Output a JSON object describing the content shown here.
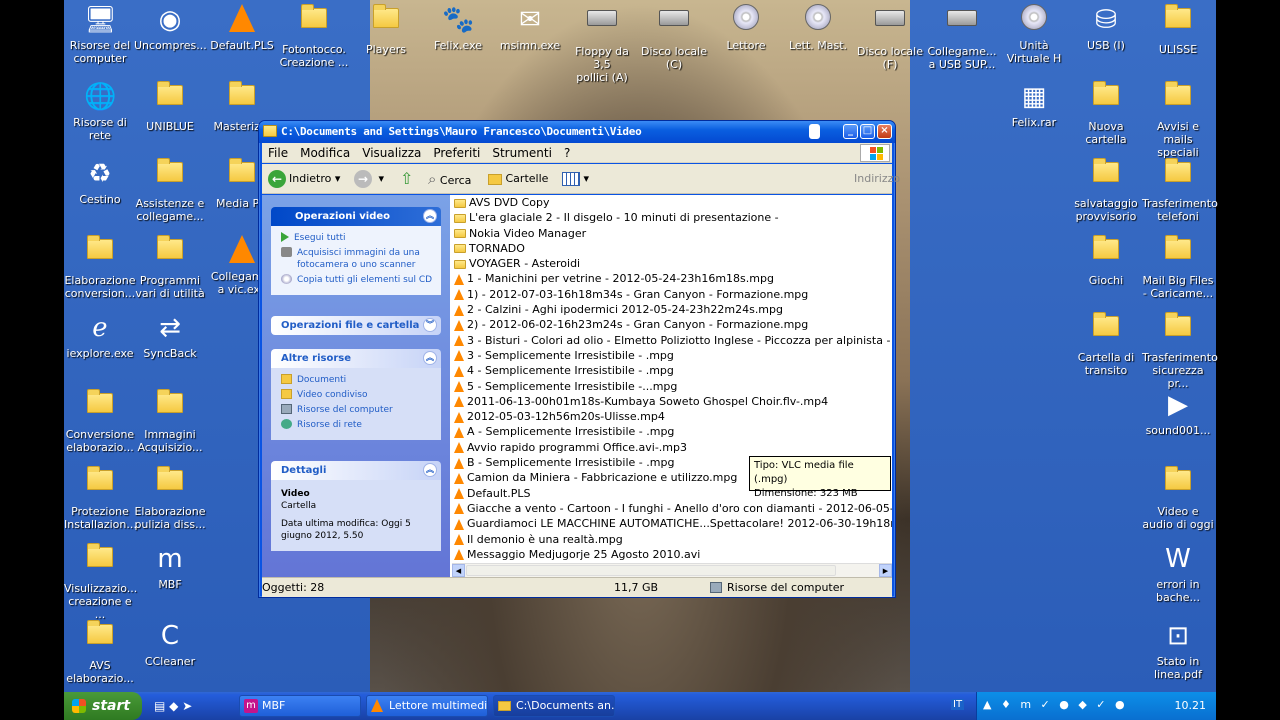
{
  "desktop": {
    "icons_top": [
      {
        "label": "Risorse del\ncomputer",
        "icon": "computer-icon"
      },
      {
        "label": "Uncompres...",
        "icon": "compressed-icon"
      },
      {
        "label": "Default.PLS",
        "icon": "vlc-icon"
      },
      {
        "label": "Fotontocco.\nCreazione ...",
        "icon": "folder-icon"
      },
      {
        "label": "Players",
        "icon": "folder-icon"
      },
      {
        "label": "Felix.exe",
        "icon": "paw-icon"
      },
      {
        "label": "msimn.exe",
        "icon": "mail-icon"
      },
      {
        "label": "Floppy da 3,5\npollici (A)",
        "icon": "floppy-icon"
      },
      {
        "label": "Disco locale\n(C)",
        "icon": "drive-icon"
      },
      {
        "label": "Lettore",
        "icon": "cd-icon"
      },
      {
        "label": "Lett. Mast.",
        "icon": "cd-icon"
      },
      {
        "label": "Disco locale\n(F)",
        "icon": "drive-icon"
      },
      {
        "label": "Collegame...\na USB SUP...",
        "icon": "drive-icon"
      },
      {
        "label": "Unità\nVirtuale H",
        "icon": "dvd-icon"
      },
      {
        "label": "USB (I)",
        "icon": "usb-icon"
      },
      {
        "label": "ULISSE",
        "icon": "folder-icon"
      }
    ],
    "icons_left": [
      {
        "label": "Risorse di rete",
        "icon": "network-icon"
      },
      {
        "label": "UNIBLUE",
        "icon": "folder-icon"
      },
      {
        "label": "Masteriz...",
        "icon": "folder-icon"
      },
      {
        "label": "Cestino",
        "icon": "recycle-bin-icon"
      },
      {
        "label": "Assistenze e\ncollegame...",
        "icon": "folder-icon"
      },
      {
        "label": "Media P...",
        "icon": "folder-icon"
      },
      {
        "label": "Elaborazione\nconversion...",
        "icon": "folder-icon"
      },
      {
        "label": "Programmi\nvari di utilità",
        "icon": "folder-icon"
      },
      {
        "label": "Collegam...\na vic.exe",
        "icon": "vlc-icon"
      },
      {
        "label": "iexplore.exe",
        "icon": "ie-icon"
      },
      {
        "label": "SyncBack",
        "icon": "syncback-icon"
      },
      {
        "label": "Conversione\nelaborazio...",
        "icon": "folder-icon"
      },
      {
        "label": "Immagini\nAcquisizio...",
        "icon": "folder-icon"
      },
      {
        "label": "Protezione\nInstallazion...",
        "icon": "folder-icon"
      },
      {
        "label": "Elaborazione\npulizia diss...",
        "icon": "folder-icon"
      },
      {
        "label": "Visulizzazio...\ncreazione e ...",
        "icon": "folder-icon"
      },
      {
        "label": "MBF",
        "icon": "mbf-icon"
      },
      {
        "label": "AVS\nelaborazio...",
        "icon": "folder-icon"
      },
      {
        "label": "CCleaner",
        "icon": "ccleaner-icon"
      }
    ],
    "icons_right": [
      {
        "label": "Felix.rar",
        "icon": "rar-icon"
      },
      {
        "label": "Nuova\ncartella",
        "icon": "folder-icon"
      },
      {
        "label": "Avvisi e mails\nspeciali",
        "icon": "folder-icon"
      },
      {
        "label": "salvataggio\nprovvisorio",
        "icon": "folder-icon"
      },
      {
        "label": "Trasferimento\ntelefoni",
        "icon": "folder-icon"
      },
      {
        "label": "Giochi",
        "icon": "folder-icon"
      },
      {
        "label": "Mail Big Files\n- Caricame...",
        "icon": "folder-icon"
      },
      {
        "label": "Cartella di\ntransito",
        "icon": "folder-icon"
      },
      {
        "label": "Trasferimento\nsicurezza pr...",
        "icon": "folder-icon"
      },
      {
        "label": "sound001...",
        "icon": "media-icon"
      },
      {
        "label": "Video e\naudio di oggi",
        "icon": "folder-icon"
      },
      {
        "label": "errori in\nbache...",
        "icon": "word-icon"
      },
      {
        "label": "Stato in\nlinea.pdf",
        "icon": "pdf-icon"
      }
    ]
  },
  "window": {
    "title": "C:\\Documents and Settings\\Mauro Francesco\\Documenti\\Video",
    "menu": [
      "File",
      "Modifica",
      "Visualizza",
      "Preferiti",
      "Strumenti",
      "?"
    ],
    "toolbar": {
      "back": "Indietro",
      "search": "Cerca",
      "folders": "Cartelle",
      "address": "Indirizzo"
    },
    "tasks": {
      "video_ops": {
        "title": "Operazioni video",
        "items": [
          "Esegui tutti",
          "Acquisisci immagini da una fotocamera o uno scanner",
          "Copia tutti gli elementi sul CD"
        ]
      },
      "file_ops": {
        "title": "Operazioni file e cartella"
      },
      "other": {
        "title": "Altre risorse",
        "items": [
          "Documenti",
          "Video condiviso",
          "Risorse del computer",
          "Risorse di rete"
        ]
      },
      "details": {
        "title": "Dettagli",
        "name": "Video",
        "type": "Cartella",
        "modified": "Data ultima modifica: Oggi 5 giugno 2012, 5.50"
      }
    },
    "files": [
      {
        "name": "AVS DVD Copy",
        "kind": "folder"
      },
      {
        "name": "L'era glaciale 2 - Il disgelo - 10 minuti di presentazione -",
        "kind": "folder"
      },
      {
        "name": "Nokia Video Manager",
        "kind": "folder"
      },
      {
        "name": "TORNADO",
        "kind": "folder"
      },
      {
        "name": "VOYAGER - Asteroidi",
        "kind": "folder"
      },
      {
        "name": "1 - Manichini per vetrine - 2012-05-24-23h16m18s.mpg",
        "kind": "vlc"
      },
      {
        "name": "1) - 2012-07-03-16h18m34s - Gran Canyon - Formazione.mpg",
        "kind": "vlc"
      },
      {
        "name": "2 - Calzini - Aghi ipodermici 2012-05-24-23h22m24s.mpg",
        "kind": "vlc"
      },
      {
        "name": "2) - 2012-06-02-16h23m24s - Gran Canyon - Formazione.mpg",
        "kind": "vlc"
      },
      {
        "name": "3 - Bisturi - Colori ad olio - Elmetto Poliziotto Inglese - Piccozza per alpinista - 2012-05-2",
        "kind": "vlc"
      },
      {
        "name": "3 - Semplicemente Irresistibile - .mpg",
        "kind": "vlc"
      },
      {
        "name": "4 - Semplicemente Irresistibile - .mpg",
        "kind": "vlc"
      },
      {
        "name": "5 - Semplicemente Irresistibile -...mpg",
        "kind": "vlc"
      },
      {
        "name": "2011-06-13-00h01m18s-Kumbaya Soweto Ghospel Choir.flv-.mp4",
        "kind": "vlc"
      },
      {
        "name": "2012-05-03-12h56m20s-Ulisse.mp4",
        "kind": "vlc"
      },
      {
        "name": "A - Semplicemente Irresistibile - .mpg",
        "kind": "vlc"
      },
      {
        "name": "Avvio rapido programmi Office.avi-.mp3",
        "kind": "vlc"
      },
      {
        "name": "B - Semplicemente Irresistibile - .mpg",
        "kind": "vlc"
      },
      {
        "name": "Camion da Miniera - Fabbricazione e utilizzo.mpg",
        "kind": "vlc"
      },
      {
        "name": "Default.PLS",
        "kind": "vlc"
      },
      {
        "name": "Giacche a vento - Cartoon - I funghi - Anello d'oro con diamanti - 2012-06-05-05h05m",
        "kind": "vlc"
      },
      {
        "name": "Guardiamoci LE MACCHINE AUTOMATICHE...Spettacolare! 2012-06-30-19h18m21s.m",
        "kind": "vlc"
      },
      {
        "name": "Il demonio è una realtà.mpg",
        "kind": "vlc"
      },
      {
        "name": "Messaggio Medjugorje 25 Agosto 2010.avi",
        "kind": "vlc"
      }
    ],
    "status": {
      "objects": "Oggetti: 28",
      "size": "11,7 GB",
      "location": "Risorse del computer"
    }
  },
  "tooltip": {
    "type": "Tipo: VLC media file (.mpg)",
    "size": "Dimensione: 323 MB"
  },
  "taskbar": {
    "start": "start",
    "tasks": [
      "MBF",
      "Lettore multimedi...",
      "C:\\Documents an..."
    ],
    "lang": "IT",
    "clock": "10.21"
  }
}
